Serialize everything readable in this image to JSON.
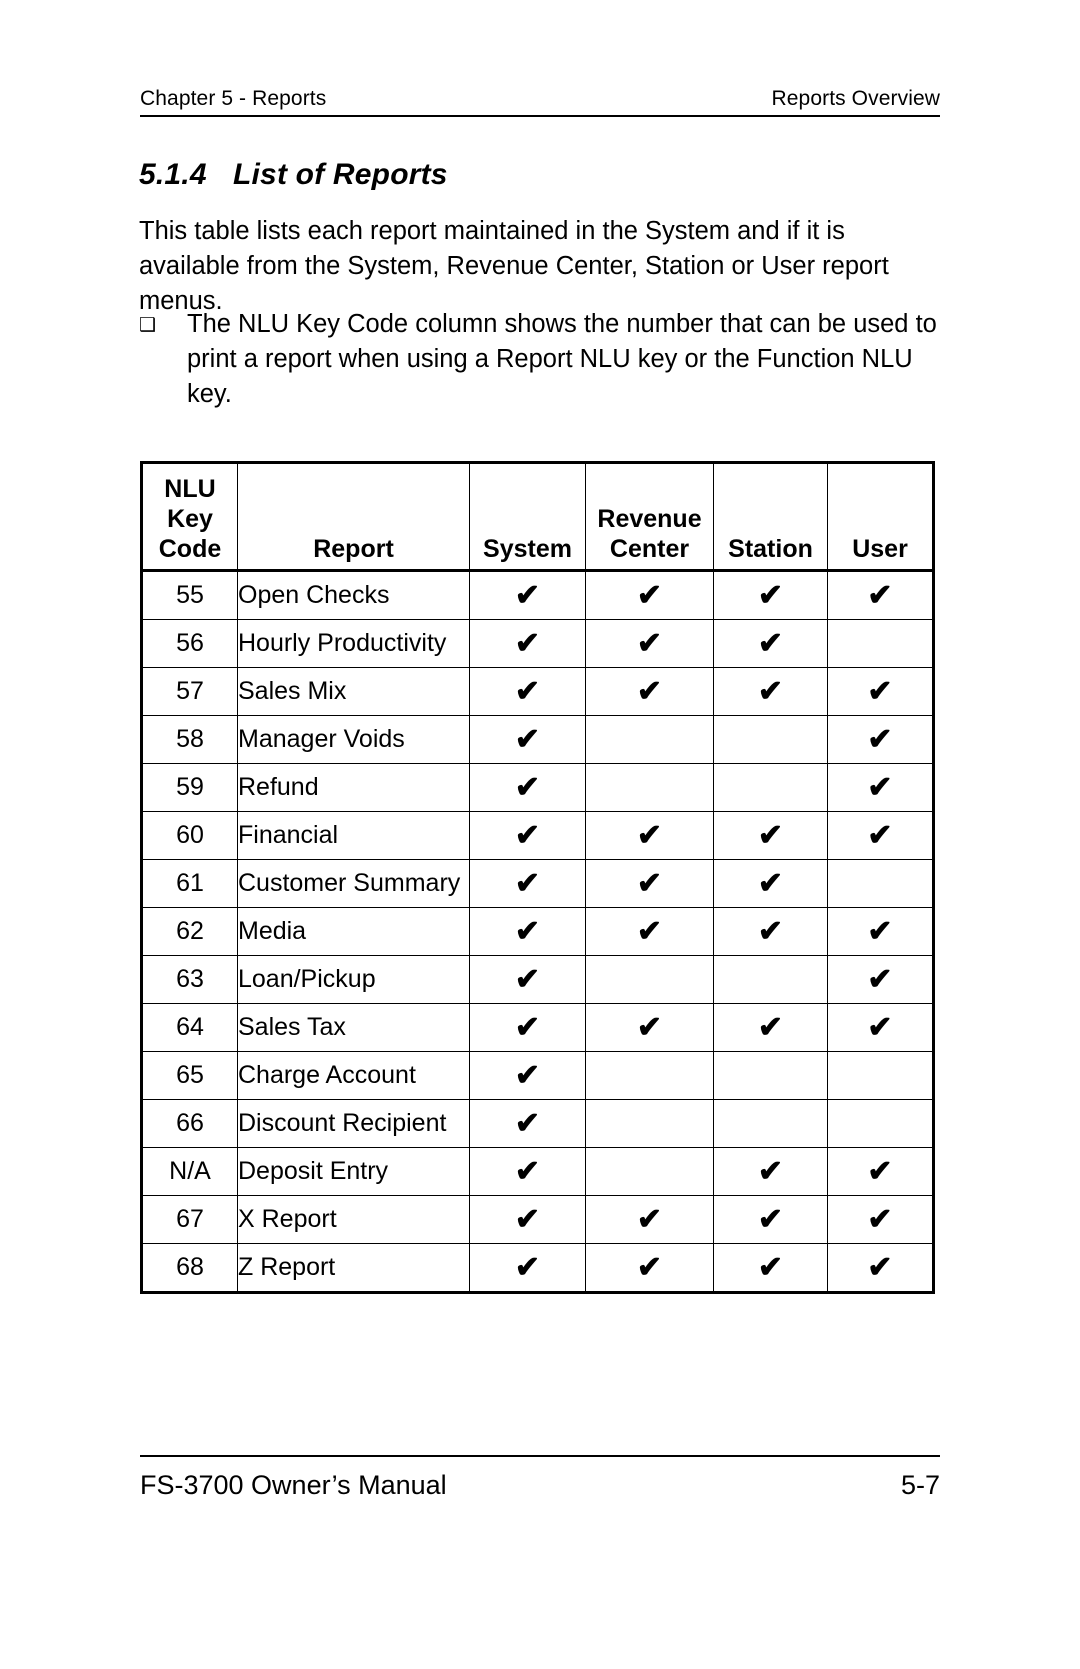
{
  "header": {
    "left": "Chapter 5 - Reports",
    "right": "Reports Overview"
  },
  "section": {
    "number": "5.1.4",
    "title": "List of Reports"
  },
  "body": {
    "paragraph": "This table lists each report maintained in the System and if it is available from the System, Revenue Center, Station or User report menus.",
    "bullet_glyph": "❑",
    "bullet_text": "The NLU Key Code column shows the number that can be used to print a report when using a Report NLU key or the Function NLU key."
  },
  "table": {
    "check_glyph": "✔",
    "columns": [
      {
        "key": "nlu",
        "lines": [
          "NLU",
          "Key",
          "Code"
        ]
      },
      {
        "key": "report",
        "lines": [
          "Report"
        ]
      },
      {
        "key": "system",
        "lines": [
          "System"
        ]
      },
      {
        "key": "revenue",
        "lines": [
          "Revenue",
          "Center"
        ]
      },
      {
        "key": "station",
        "lines": [
          "Station"
        ]
      },
      {
        "key": "user",
        "lines": [
          "User"
        ]
      }
    ],
    "rows": [
      {
        "code": "55",
        "report": "Open Checks",
        "system": true,
        "revenue": true,
        "station": true,
        "user": true
      },
      {
        "code": "56",
        "report": "Hourly Productivity",
        "system": true,
        "revenue": true,
        "station": true,
        "user": false
      },
      {
        "code": "57",
        "report": "Sales Mix",
        "system": true,
        "revenue": true,
        "station": true,
        "user": true
      },
      {
        "code": "58",
        "report": "Manager Voids",
        "system": true,
        "revenue": false,
        "station": false,
        "user": true
      },
      {
        "code": "59",
        "report": "Refund",
        "system": true,
        "revenue": false,
        "station": false,
        "user": true
      },
      {
        "code": "60",
        "report": "Financial",
        "system": true,
        "revenue": true,
        "station": true,
        "user": true
      },
      {
        "code": "61",
        "report": "Customer Summary",
        "system": true,
        "revenue": true,
        "station": true,
        "user": false
      },
      {
        "code": "62",
        "report": "Media",
        "system": true,
        "revenue": true,
        "station": true,
        "user": true
      },
      {
        "code": "63",
        "report": "Loan/Pickup",
        "system": true,
        "revenue": false,
        "station": false,
        "user": true
      },
      {
        "code": "64",
        "report": "Sales Tax",
        "system": true,
        "revenue": true,
        "station": true,
        "user": true
      },
      {
        "code": "65",
        "report": "Charge Account",
        "system": true,
        "revenue": false,
        "station": false,
        "user": false
      },
      {
        "code": "66",
        "report": "Discount Recipient",
        "system": true,
        "revenue": false,
        "station": false,
        "user": false
      },
      {
        "code": "N/A",
        "report": "Deposit Entry",
        "system": true,
        "revenue": false,
        "station": true,
        "user": true
      },
      {
        "code": "67",
        "report": "X Report",
        "system": true,
        "revenue": true,
        "station": true,
        "user": true
      },
      {
        "code": "68",
        "report": "Z Report",
        "system": true,
        "revenue": true,
        "station": true,
        "user": true
      }
    ]
  },
  "footer": {
    "left": "FS-3700 Owner’s Manual",
    "right": "5-7"
  }
}
